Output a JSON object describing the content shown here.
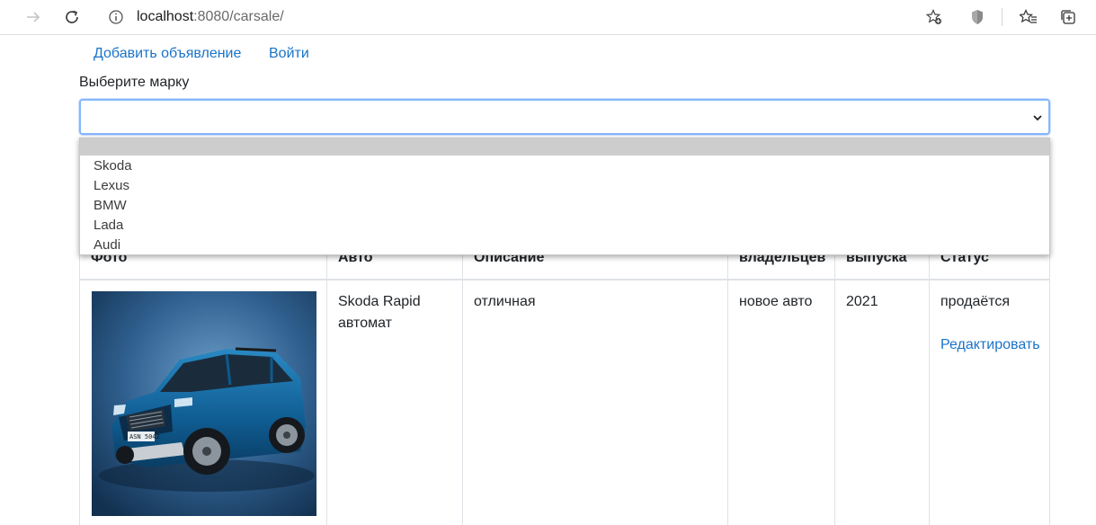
{
  "browser": {
    "url_host": "localhost",
    "url_rest": ":8080/carsale/"
  },
  "nav": {
    "add_listing": "Добавить объявление",
    "login": "Войти"
  },
  "filter": {
    "label": "Выберите марку",
    "selected": "",
    "options": [
      "",
      "Skoda",
      "Lexus",
      "BMW",
      "Lada",
      "Audi"
    ]
  },
  "table": {
    "headers": {
      "photo": "Фото",
      "auto": "Авто",
      "description": "Описание",
      "owners": "владельцев",
      "year": "выпуска",
      "status": "Статус"
    },
    "rows": [
      {
        "auto_line1": "Skoda Rapid",
        "auto_line2": "автомат",
        "description": "отличная",
        "owners": "новое авто",
        "year": "2021",
        "status": "продаётся",
        "edit": "Редактировать",
        "plate": "ASN 5042"
      }
    ]
  },
  "colors": {
    "link": "#1a73c9",
    "focus_border": "#86b7fe",
    "option_highlight": "#cdcdcd"
  }
}
